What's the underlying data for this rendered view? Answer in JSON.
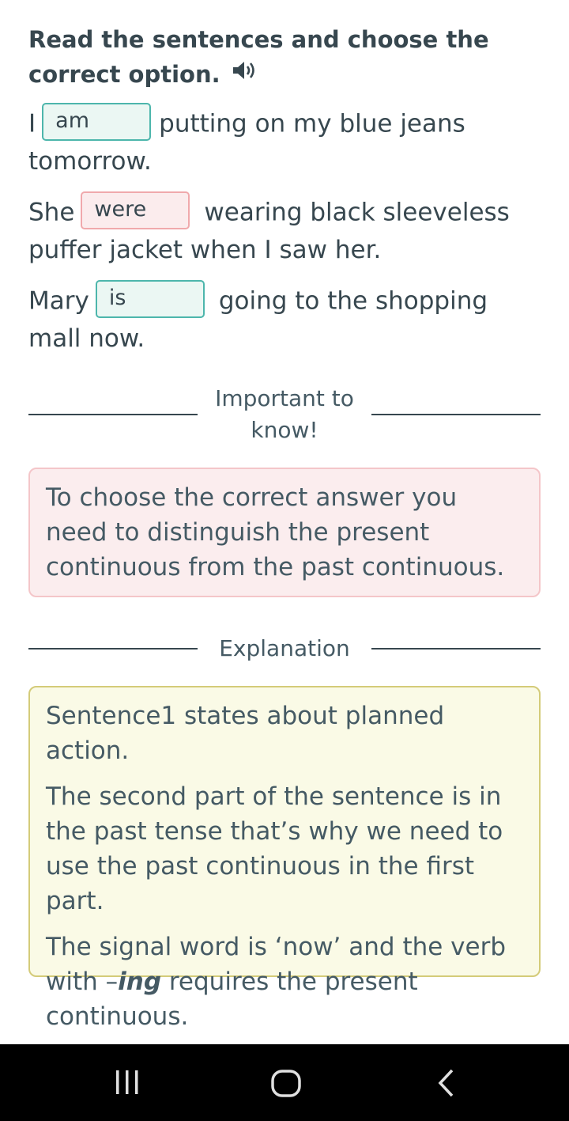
{
  "title": "Read the sentences and choose the correct option.",
  "sentences": [
    {
      "before": "I",
      "answer": "am",
      "after": "putting on my blue jeans tomorrow."
    },
    {
      "before": "She",
      "answer": "were",
      "after": "wearing black sleeveless puffer jacket when I saw her."
    },
    {
      "before": "Mary",
      "answer": "is",
      "after": "going to the shopping mall now."
    }
  ],
  "important": {
    "heading": "Important to know!",
    "text": "To choose the correct answer you need to distinguish the present continuous from the past continuous."
  },
  "explanation": {
    "heading": "Explanation",
    "p1": "Sentence1 states about planned action.",
    "p2": "The second part of the sentence is in the past tense that’s why we need to use the past continuous in the first part.",
    "p3_before": "The signal word is ‘now’ and the verb with –",
    "p3_em": "ing",
    "p3_after": " requires the present continuous."
  },
  "icons": {
    "speaker": "speaker-icon",
    "recents": "recent-apps-icon",
    "home": "home-icon",
    "back": "back-icon"
  },
  "colors": {
    "correct_border": "#4db6ac",
    "wrong_border": "#f0a9ac",
    "important_bg": "#fbedee",
    "explanation_bg": "#fafae6"
  }
}
